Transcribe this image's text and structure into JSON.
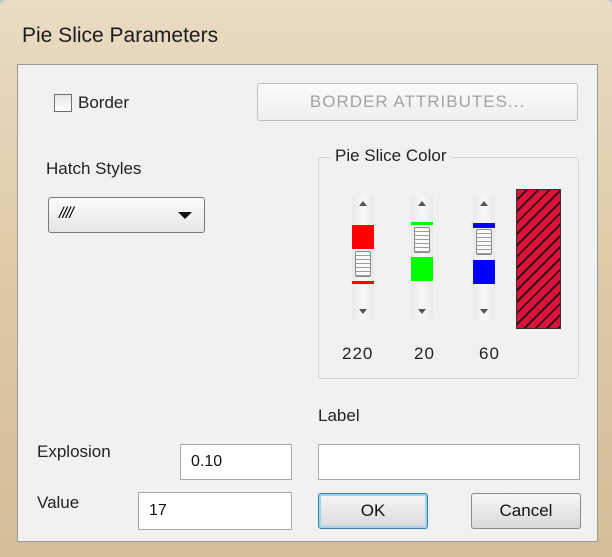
{
  "window": {
    "title": "Pie Slice Parameters"
  },
  "border": {
    "label": "Border",
    "checked": false
  },
  "border_attributes_button": {
    "label": "BORDER ATTRIBUTES..."
  },
  "hatch": {
    "label": "Hatch Styles",
    "selected": "////"
  },
  "pie_slice_color": {
    "label": "Pie Slice Color",
    "red": 220,
    "green": 20,
    "blue": 60,
    "red_display": "220",
    "green_display": "20",
    "blue_display": "60",
    "swatch_color": "#dc143c"
  },
  "label_field": {
    "label": "Label",
    "value": ""
  },
  "explosion": {
    "label": "Explosion",
    "value": "0.10"
  },
  "value": {
    "label": "Value",
    "value": "17"
  },
  "buttons": {
    "ok": "OK",
    "cancel": "Cancel"
  },
  "colors": {
    "red": "#ff0000",
    "green": "#00ff00",
    "blue": "#0000ff",
    "default_button_accent": "#3c7fb1"
  }
}
